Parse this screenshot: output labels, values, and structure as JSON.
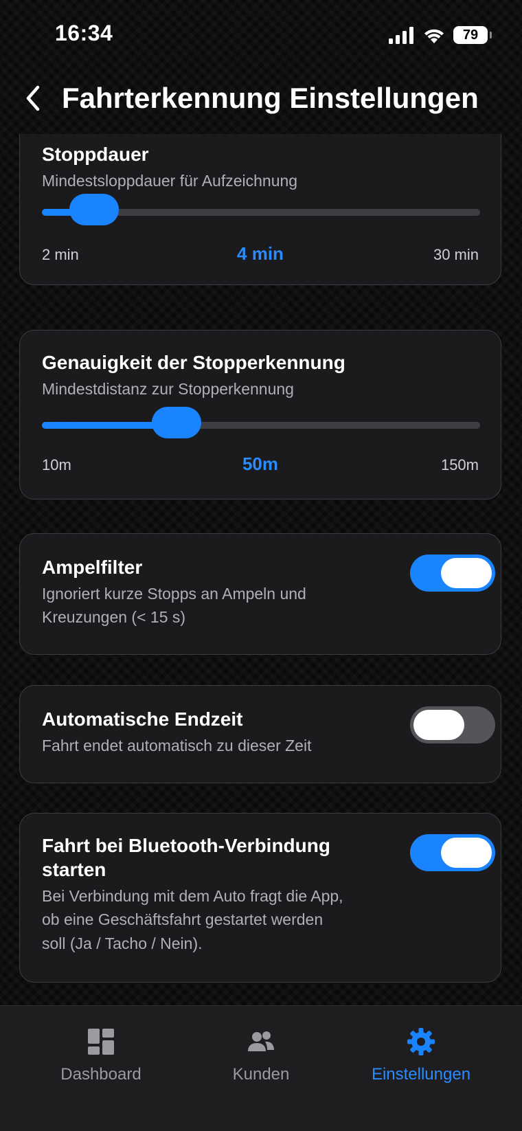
{
  "status_bar": {
    "time": "16:34",
    "battery": "79",
    "icons": [
      "signal-icon",
      "wifi-icon",
      "battery-icon"
    ]
  },
  "header": {
    "title": "Fahrterkennung Einstellungen",
    "back_icon": "chevron-left-icon"
  },
  "colors": {
    "accent": "#1a84ff",
    "card_bg": "#1c1c20",
    "toggle_off": "#555559"
  },
  "settings": {
    "stop_duration": {
      "title": "Stoppdauer",
      "description": "Mindestsloppdauer für Aufzeichnung",
      "min_label": "2 min",
      "value_label": "4 min",
      "max_label": "30 min",
      "value": 4,
      "min": 2,
      "max": 30
    },
    "stop_accuracy": {
      "title": "Genauigkeit der Stopperkennung",
      "description": "Mindestdistanz zur Stopperkennung",
      "min_label": "10m",
      "value_label": "50m",
      "max_label": "150m",
      "value": 50,
      "min": 10,
      "max": 150
    },
    "traffic_light_filter": {
      "title": "Ampelfilter",
      "description_line1": "Ignoriert kurze Stopps an Ampeln und",
      "description_line2": "Kreuzungen (< 15 s)",
      "enabled": true
    },
    "auto_end_time": {
      "title": "Automatische Endzeit",
      "description": "Fahrt endet automatisch zu dieser Zeit",
      "enabled": false
    },
    "bluetooth_start": {
      "title_line1": "Fahrt bei Bluetooth-Verbindung",
      "title_line2": "starten",
      "description_line1": "Bei Verbindung mit dem Auto fragt die App,",
      "description_line2": "ob eine Geschäftsfahrt gestartet werden",
      "description_line3": "soll (Ja / Tacho / Nein).",
      "enabled": true
    }
  },
  "tab_bar": {
    "tabs": [
      {
        "label": "Dashboard",
        "icon": "dashboard-icon",
        "active": false
      },
      {
        "label": "Kunden",
        "icon": "people-icon",
        "active": false
      },
      {
        "label": "Einstellungen",
        "icon": "gear-icon",
        "active": true
      }
    ]
  }
}
